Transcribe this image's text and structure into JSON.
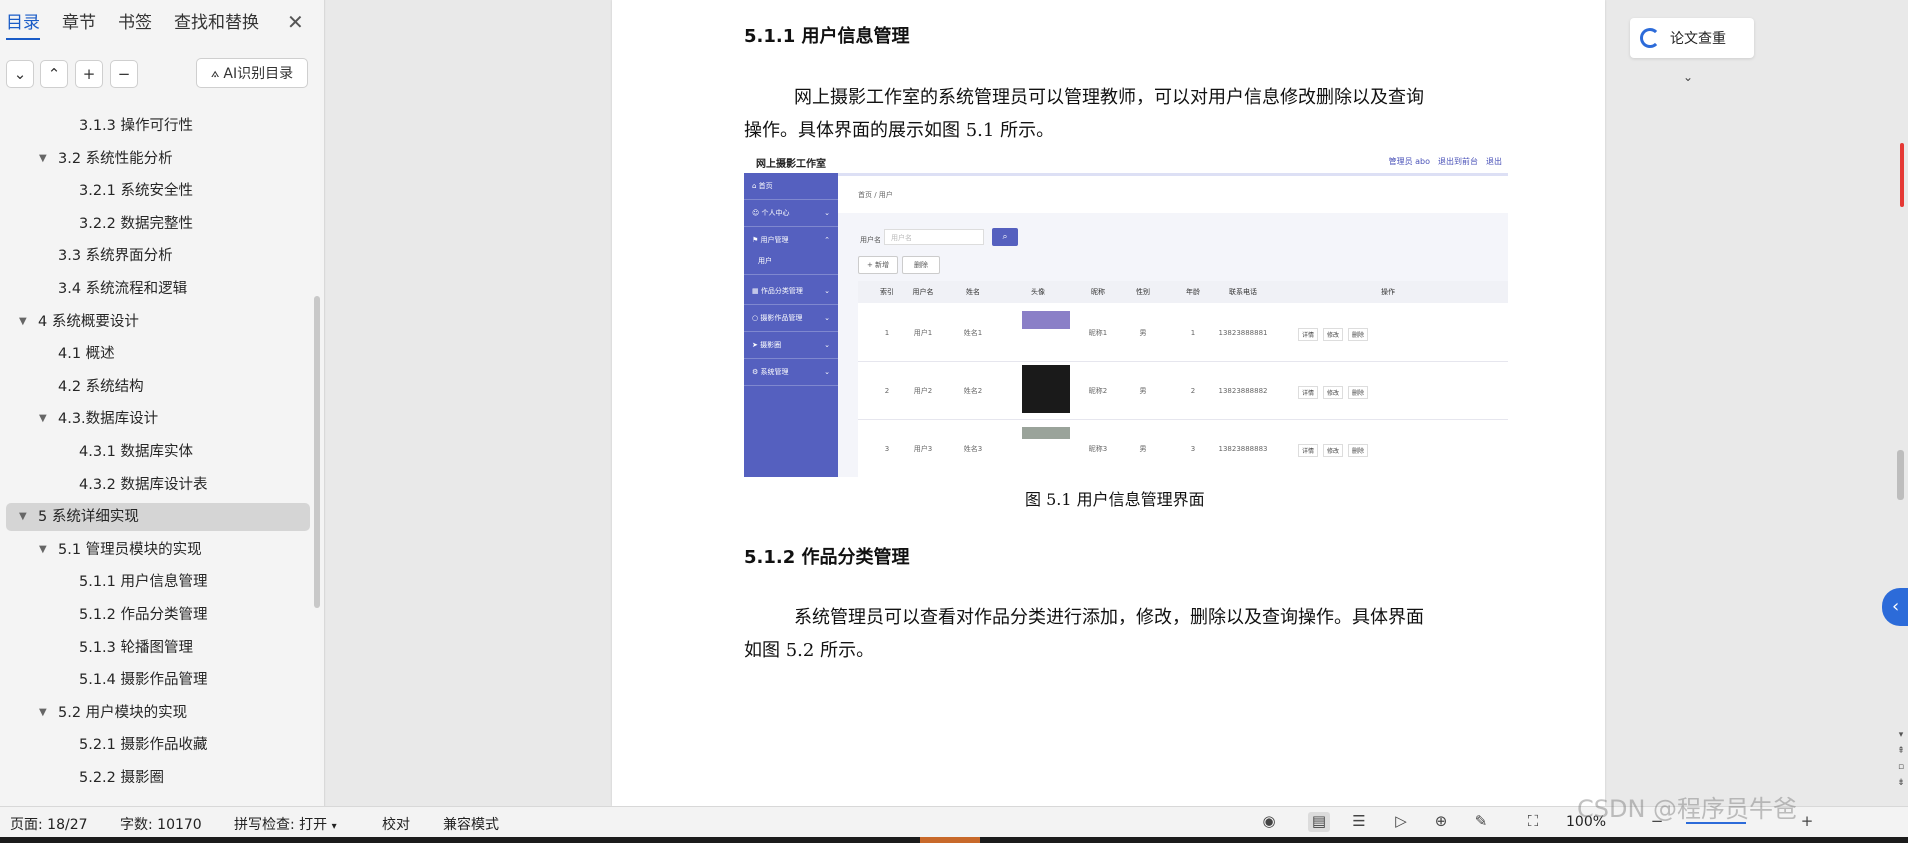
{
  "nav": {
    "tabs": [
      "目录",
      "章节",
      "书签",
      "查找和替换"
    ],
    "ai_button": "AI识别目录",
    "toc": [
      {
        "label": "3.1.3 操作可行性",
        "level": 3,
        "collapsible": false
      },
      {
        "label": "3.2 系统性能分析",
        "level": 2,
        "collapsible": true
      },
      {
        "label": "3.2.1 系统安全性",
        "level": 3,
        "collapsible": false
      },
      {
        "label": "3.2.2 数据完整性",
        "level": 3,
        "collapsible": false
      },
      {
        "label": "3.3 系统界面分析",
        "level": 2,
        "collapsible": false
      },
      {
        "label": "3.4 系统流程和逻辑",
        "level": 2,
        "collapsible": false
      },
      {
        "label": "4 系统概要设计",
        "level": 1,
        "collapsible": true
      },
      {
        "label": "4.1 概述",
        "level": 2,
        "collapsible": false
      },
      {
        "label": "4.2 系统结构",
        "level": 2,
        "collapsible": false
      },
      {
        "label": "4.3.数据库设计",
        "level": 2,
        "collapsible": true
      },
      {
        "label": "4.3.1 数据库实体",
        "level": 3,
        "collapsible": false
      },
      {
        "label": "4.3.2 数据库设计表",
        "level": 3,
        "collapsible": false
      },
      {
        "label": "5 系统详细实现",
        "level": 1,
        "collapsible": true,
        "selected": true
      },
      {
        "label": "5.1 管理员模块的实现",
        "level": 2,
        "collapsible": true
      },
      {
        "label": "5.1.1 用户信息管理",
        "level": 3,
        "collapsible": false
      },
      {
        "label": "5.1.2 作品分类管理",
        "level": 3,
        "collapsible": false
      },
      {
        "label": "5.1.3 轮播图管理",
        "level": 3,
        "collapsible": false
      },
      {
        "label": "5.1.4 摄影作品管理",
        "level": 3,
        "collapsible": false
      },
      {
        "label": "5.2 用户模块的实现",
        "level": 2,
        "collapsible": true
      },
      {
        "label": "5.2.1 摄影作品收藏",
        "level": 3,
        "collapsible": false
      },
      {
        "label": "5.2.2 摄影圈",
        "level": 3,
        "collapsible": false
      }
    ]
  },
  "doc": {
    "h_511": "5.1.1 用户信息管理",
    "p1_line1": "网上摄影工作室的系统管理员可以管理教师，可以对用户信息修改删除以及查询",
    "p1_line2": "操作。具体界面的展示如图 5.1 所示。",
    "caption": "图 5.1 用户信息管理界面",
    "h_512": "5.1.2 作品分类管理",
    "p2_line1": "系统管理员可以查看对作品分类进行添加，修改，删除以及查询操作。具体界面",
    "p2_line2": "如图 5.2 所示。"
  },
  "shot": {
    "title": "网上摄影工作室",
    "top_right": "管理员 abo　退出到前台　退出",
    "side": [
      "首页",
      "个人中心",
      "用户管理",
      "用户",
      "作品分类管理",
      "摄影作品管理",
      "摄影圈",
      "系统管理"
    ],
    "crumb": "首页 / 用户",
    "search_label": "用户名",
    "search_placeholder": "用户名",
    "add": "+ 新增",
    "del": "删除",
    "headers": [
      "",
      "索引",
      "用户名",
      "姓名",
      "头像",
      "昵称",
      "性别",
      "年龄",
      "联系电话",
      "操作"
    ],
    "rows": [
      [
        "1",
        "用户1",
        "姓名1",
        "昵称1",
        "男",
        "1",
        "13823888881"
      ],
      [
        "2",
        "用户2",
        "姓名2",
        "昵称2",
        "男",
        "2",
        "13823888882"
      ],
      [
        "3",
        "用户3",
        "姓名3",
        "昵称3",
        "男",
        "3",
        "13823888883"
      ]
    ],
    "actions": [
      "详情",
      "修改",
      "删除"
    ]
  },
  "right": {
    "check_label": "论文查重"
  },
  "status": {
    "page": "页面: 18/27",
    "words": "字数: 10170",
    "spell": "拼写检查: 打开",
    "proof": "校对",
    "compat": "兼容模式",
    "zoom": "100%",
    "watermark": "CSDN @程序员牛爸"
  },
  "colors": {
    "accent": "#1a5cc7",
    "sidebar": "#5560bf"
  }
}
